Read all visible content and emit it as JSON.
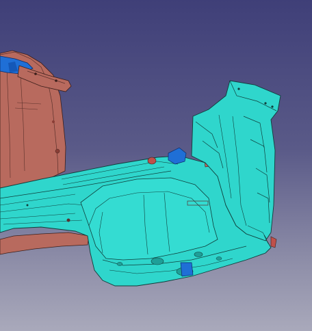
{
  "viewer": {
    "background_top": "#3f3f78",
    "background_bottom": "#a9a9bb"
  },
  "model": {
    "parts": [
      {
        "name": "rear-side-member",
        "color": "#b86a5e"
      },
      {
        "name": "floor-panel",
        "color": "#2fd6cc"
      },
      {
        "name": "spare-wheel-well",
        "color": "#2fd6cc"
      },
      {
        "name": "wheelhouse-inner",
        "color": "#2fd6cc"
      },
      {
        "name": "reinforcement-bracket",
        "color": "#1f6fd6"
      },
      {
        "name": "rear-crossmember-blue",
        "color": "#1f6fd6"
      }
    ],
    "outline_color": "#1a2a2a"
  }
}
